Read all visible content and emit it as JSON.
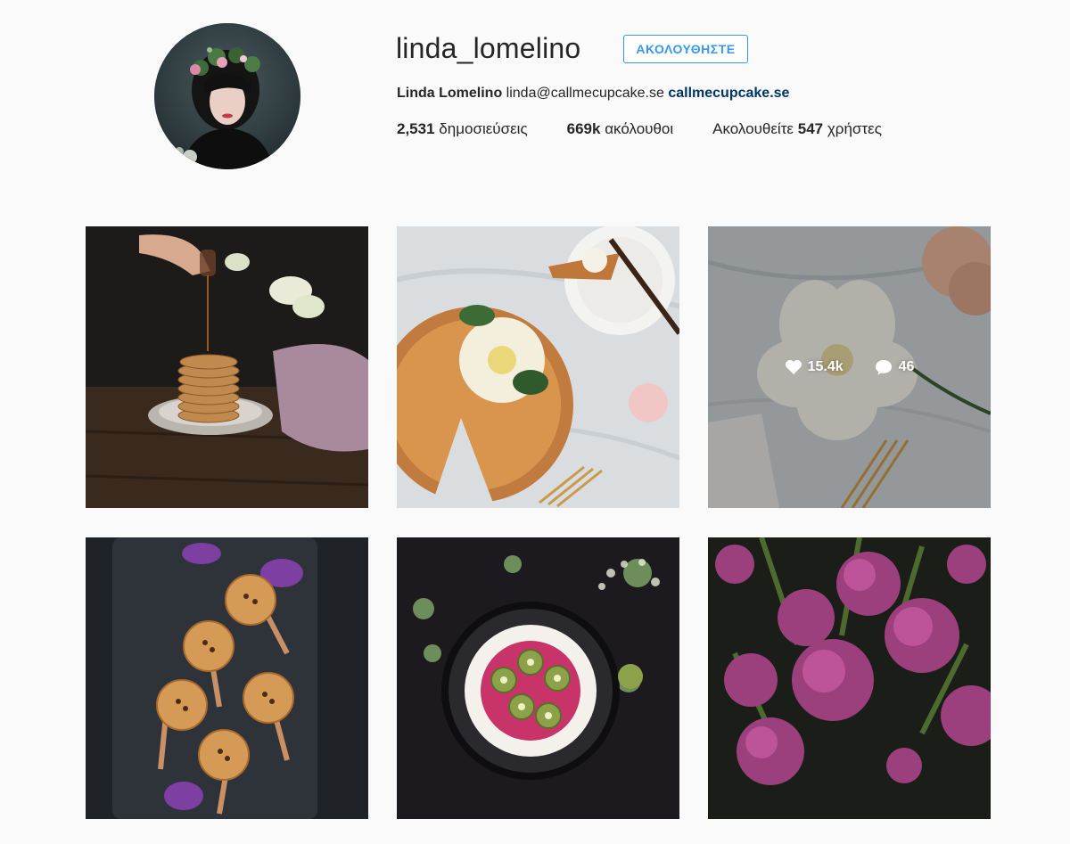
{
  "profile": {
    "username": "linda_lomelino",
    "follow_label": "ΑΚΟΛΟΥΘΗΣΤΕ",
    "full_name": "Linda Lomelino",
    "email": "linda@callmecupcake.se",
    "website": "callmecupcake.se"
  },
  "stats": {
    "posts_count": "2,531",
    "posts_label": "δημοσιεύσεις",
    "followers_count": "669k",
    "followers_label": "ακόλουθοι",
    "following_prefix": "Ακολουθείτε",
    "following_count": "547",
    "following_suffix": "χρήστες"
  },
  "hover_post": {
    "likes": "15.4k",
    "comments": "46"
  },
  "colors": {
    "accent": "#3897f0",
    "link": "#003569",
    "background": "#fafafa"
  }
}
